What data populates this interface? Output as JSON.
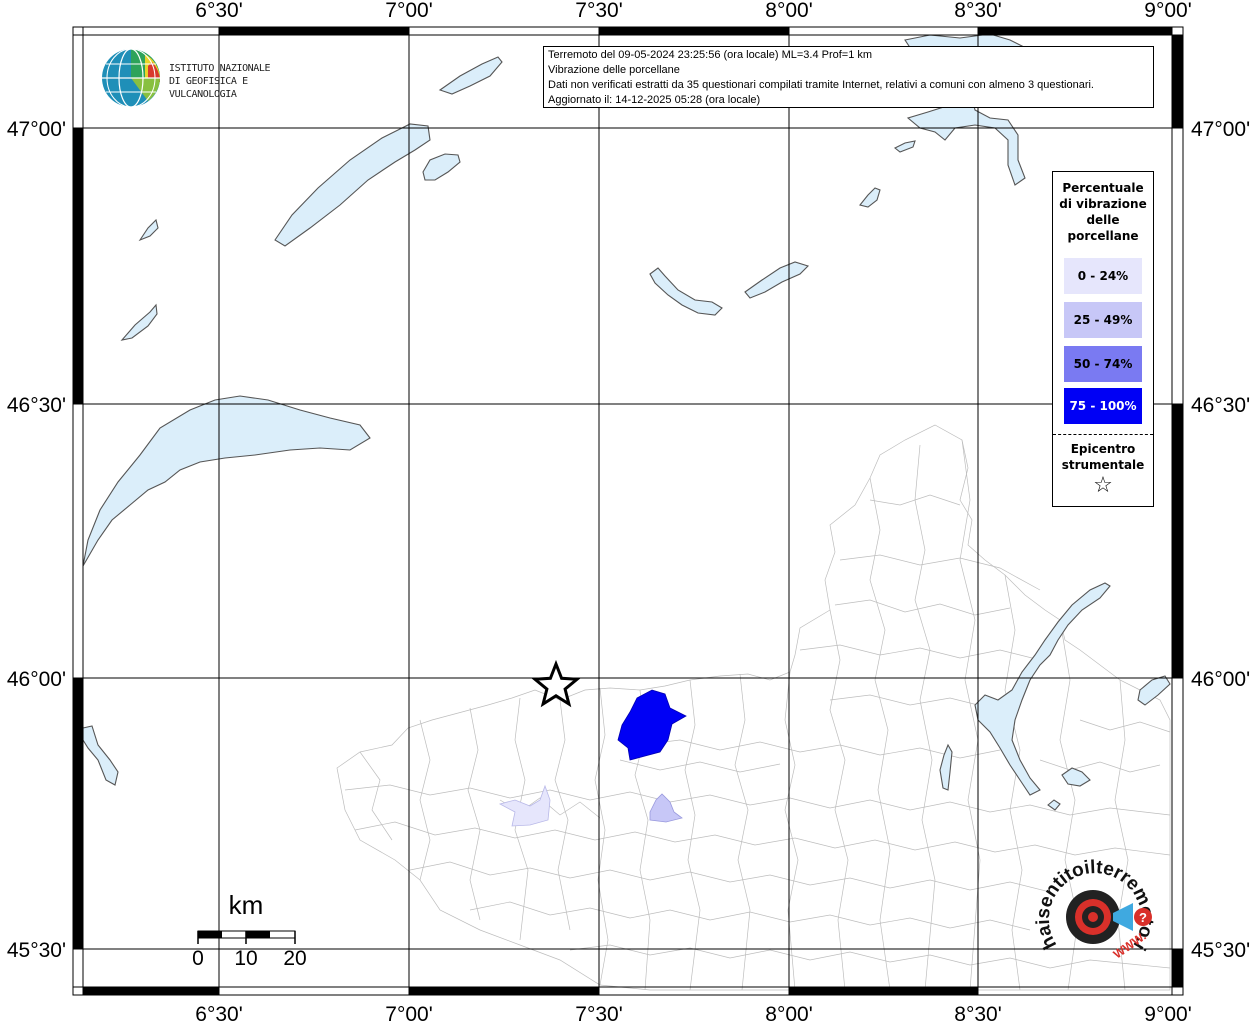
{
  "map": {
    "lon_ticks": [
      "6°30'",
      "7°00'",
      "7°30'",
      "8°00'",
      "8°30'",
      "9°00'"
    ],
    "lat_ticks": [
      "47°00'",
      "46°30'",
      "46°00'",
      "45°30'"
    ],
    "lon_range": [
      "6°10'",
      "9°00'"
    ],
    "lat_range": [
      "45°28'",
      "47°10'"
    ],
    "projection": "rectangular lat/lon grid, 30' spacing"
  },
  "info": {
    "line1": "Terremoto del 09-05-2024 23:25:56 (ora locale) ML=3.4 Prof=1 km",
    "line2": "Vibrazione delle porcellane",
    "line3": "Dati non verificati estratti da 35 questionari compilati tramite Internet, relativi a comuni con almeno 3 questionari.",
    "line4": "Aggiornato il: 14-12-2025 05:28 (ora locale)"
  },
  "legend": {
    "title": "Percentuale di vibrazione delle porcellane",
    "items": [
      {
        "label": "0 - 24%",
        "color": "#e6e6fc",
        "text_color": "#000000"
      },
      {
        "label": "25 - 49%",
        "color": "#c7c7f7",
        "text_color": "#000000"
      },
      {
        "label": "50 - 74%",
        "color": "#7a7af2",
        "text_color": "#000000"
      },
      {
        "label": "75 - 100%",
        "color": "#0000f5",
        "text_color": "#ffffff"
      }
    ],
    "epicenter_label": "Epicentro strumentale",
    "epicenter_symbol": "☆"
  },
  "scale_bar": {
    "unit": "km",
    "labels": [
      "0",
      "10",
      "20"
    ]
  },
  "logos": {
    "ingv_line1": "ISTITUTO NAZIONALE",
    "ingv_line2": "DI GEOFISICA E VULCANOLOGIA",
    "hst_text": "haisentitoilterremoto.it",
    "hst_www": "WWW.",
    "hst_arc": "haisentitoilterremoto.it"
  },
  "communes_with_data": [
    {
      "class": "75 - 100%",
      "color": "#0000f5"
    },
    {
      "class": "25 - 49%",
      "color": "#c7c7f7"
    },
    {
      "class": "0 - 24%",
      "color": "#e6e6fc"
    }
  ],
  "colors": {
    "lake_fill": "#dbeefa",
    "commune_border": "#bdbdbd",
    "frame": "#000000"
  }
}
